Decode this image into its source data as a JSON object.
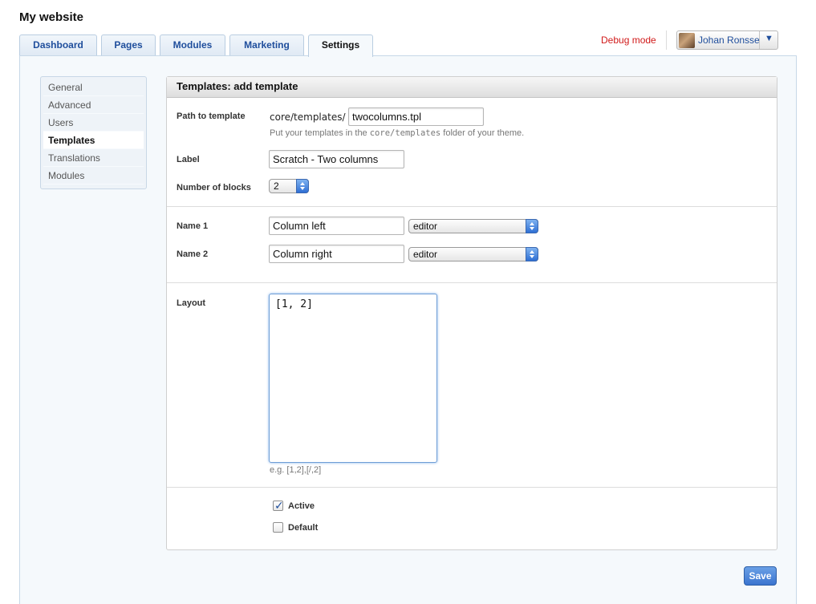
{
  "site": {
    "title": "My website"
  },
  "tabs": [
    {
      "label": "Dashboard"
    },
    {
      "label": "Pages"
    },
    {
      "label": "Modules"
    },
    {
      "label": "Marketing"
    },
    {
      "label": "Settings",
      "active": true
    }
  ],
  "header": {
    "debug_label": "Debug mode",
    "user_name": "Johan Ronsse",
    "caret": "▼"
  },
  "subnav": {
    "items": [
      {
        "label": "General"
      },
      {
        "label": "Advanced"
      },
      {
        "label": "Users"
      },
      {
        "label": "Templates",
        "active": true
      },
      {
        "label": "Translations"
      },
      {
        "label": "Modules"
      }
    ]
  },
  "panel": {
    "title": "Templates: add template",
    "path": {
      "label": "Path to template",
      "prefix": "core/templates/",
      "value": "twocolumns.tpl",
      "hint_before": "Put your templates in the ",
      "hint_code": "core/templates",
      "hint_after": " folder of your theme."
    },
    "label_field": {
      "label": "Label",
      "value": "Scratch - Two columns"
    },
    "blocks": {
      "label": "Number of blocks",
      "value": "2"
    },
    "names": [
      {
        "label": "Name 1",
        "value": "Column left",
        "type": "editor"
      },
      {
        "label": "Name 2",
        "value": "Column right",
        "type": "editor"
      }
    ],
    "layout": {
      "label": "Layout",
      "value": "[1, 2]",
      "hint": "e.g. [1,2],[/,2]"
    },
    "active": {
      "label": "Active",
      "checked": true
    },
    "default": {
      "label": "Default",
      "checked": false
    }
  },
  "actions": {
    "save_label": "Save"
  },
  "colors": {
    "accent": "#1f4e9c",
    "debug": "#d11a1a",
    "save_button": "#3a74cf"
  }
}
